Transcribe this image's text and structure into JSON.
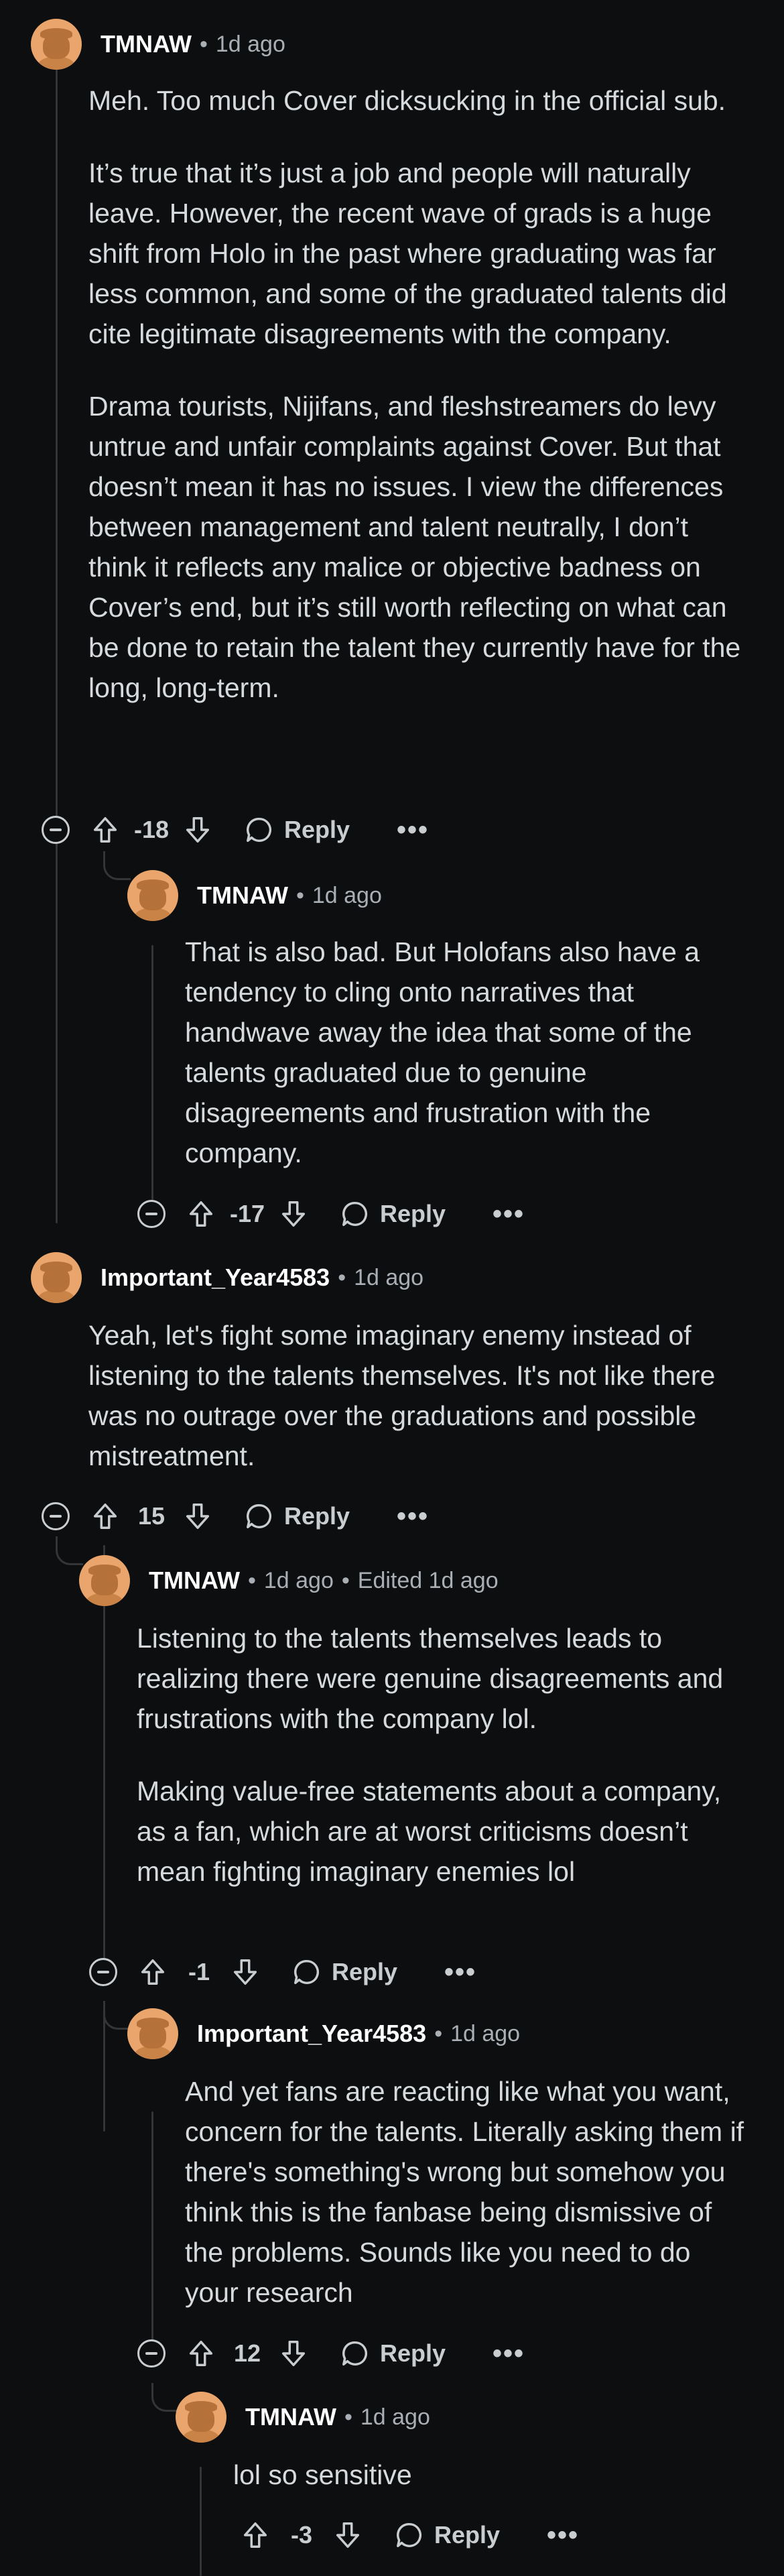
{
  "comments": [
    {
      "username": "TMNAW",
      "meta": "1d ago",
      "paragraphs": [
        "Meh. Too much Cover dicksucking in the official sub.",
        "It’s true that it’s just a job and people will naturally leave. However, the recent wave of grads is a huge shift from Holo in the past where graduating was far less common, and some of the graduated talents did cite legitimate disagreements with the company.",
        "Drama tourists, Nijifans, and fleshstreamers do levy untrue and unfair complaints against Cover. But that doesn’t mean it has no issues. I view the differences between management and talent neutrally, I don’t think it reflects any malice or objective badness on Cover’s end, but it’s still worth reflecting on what can be done to retain the talent they currently have for the long, long-term."
      ],
      "score": "-18",
      "reply_label": "Reply",
      "more_label": "•••"
    },
    {
      "username": "TMNAW",
      "meta": "1d ago",
      "paragraphs": [
        "That is also bad. But Holofans also have a tendency to cling onto narratives that handwave away the idea that some of the talents graduated due to genuine disagreements and frustration with the company."
      ],
      "score": "-17",
      "reply_label": "Reply",
      "more_label": "•••"
    },
    {
      "username": "Important_Year4583",
      "meta": "1d ago",
      "paragraphs": [
        "Yeah, let's fight some imaginary enemy instead of listening to the talents themselves. It's not like there was no outrage over the graduations and possible mistreatment."
      ],
      "score": "15",
      "reply_label": "Reply",
      "more_label": "•••"
    },
    {
      "username": "TMNAW",
      "meta": "1d ago",
      "edited": "Edited 1d ago",
      "paragraphs": [
        "Listening to the talents themselves leads to realizing there were genuine disagreements and frustrations with the company lol.",
        "Making value-free statements about a company, as a fan, which are at worst criticisms doesn’t mean fighting imaginary enemies lol"
      ],
      "score": "-1",
      "reply_label": "Reply",
      "more_label": "•••"
    },
    {
      "username": "Important_Year4583",
      "meta": "1d ago",
      "paragraphs": [
        "And yet fans are reacting like what you want, concern for the talents. Literally asking them if there's something's wrong but somehow you think this is the fanbase being dismissive of the problems. Sounds like you need to do your research"
      ],
      "score": "12",
      "reply_label": "Reply",
      "more_label": "•••"
    },
    {
      "username": "TMNAW",
      "meta": "1d ago",
      "paragraphs": [
        "lol so sensitive"
      ],
      "score": "-3",
      "reply_label": "Reply",
      "more_label": "•••"
    }
  ],
  "colors": {
    "background": "#0c0e10",
    "text": "#d7dadc",
    "username": "#ffffff",
    "meta": "#a9afb4",
    "thread_line": "#343536",
    "avatar": "#e9a56b"
  }
}
